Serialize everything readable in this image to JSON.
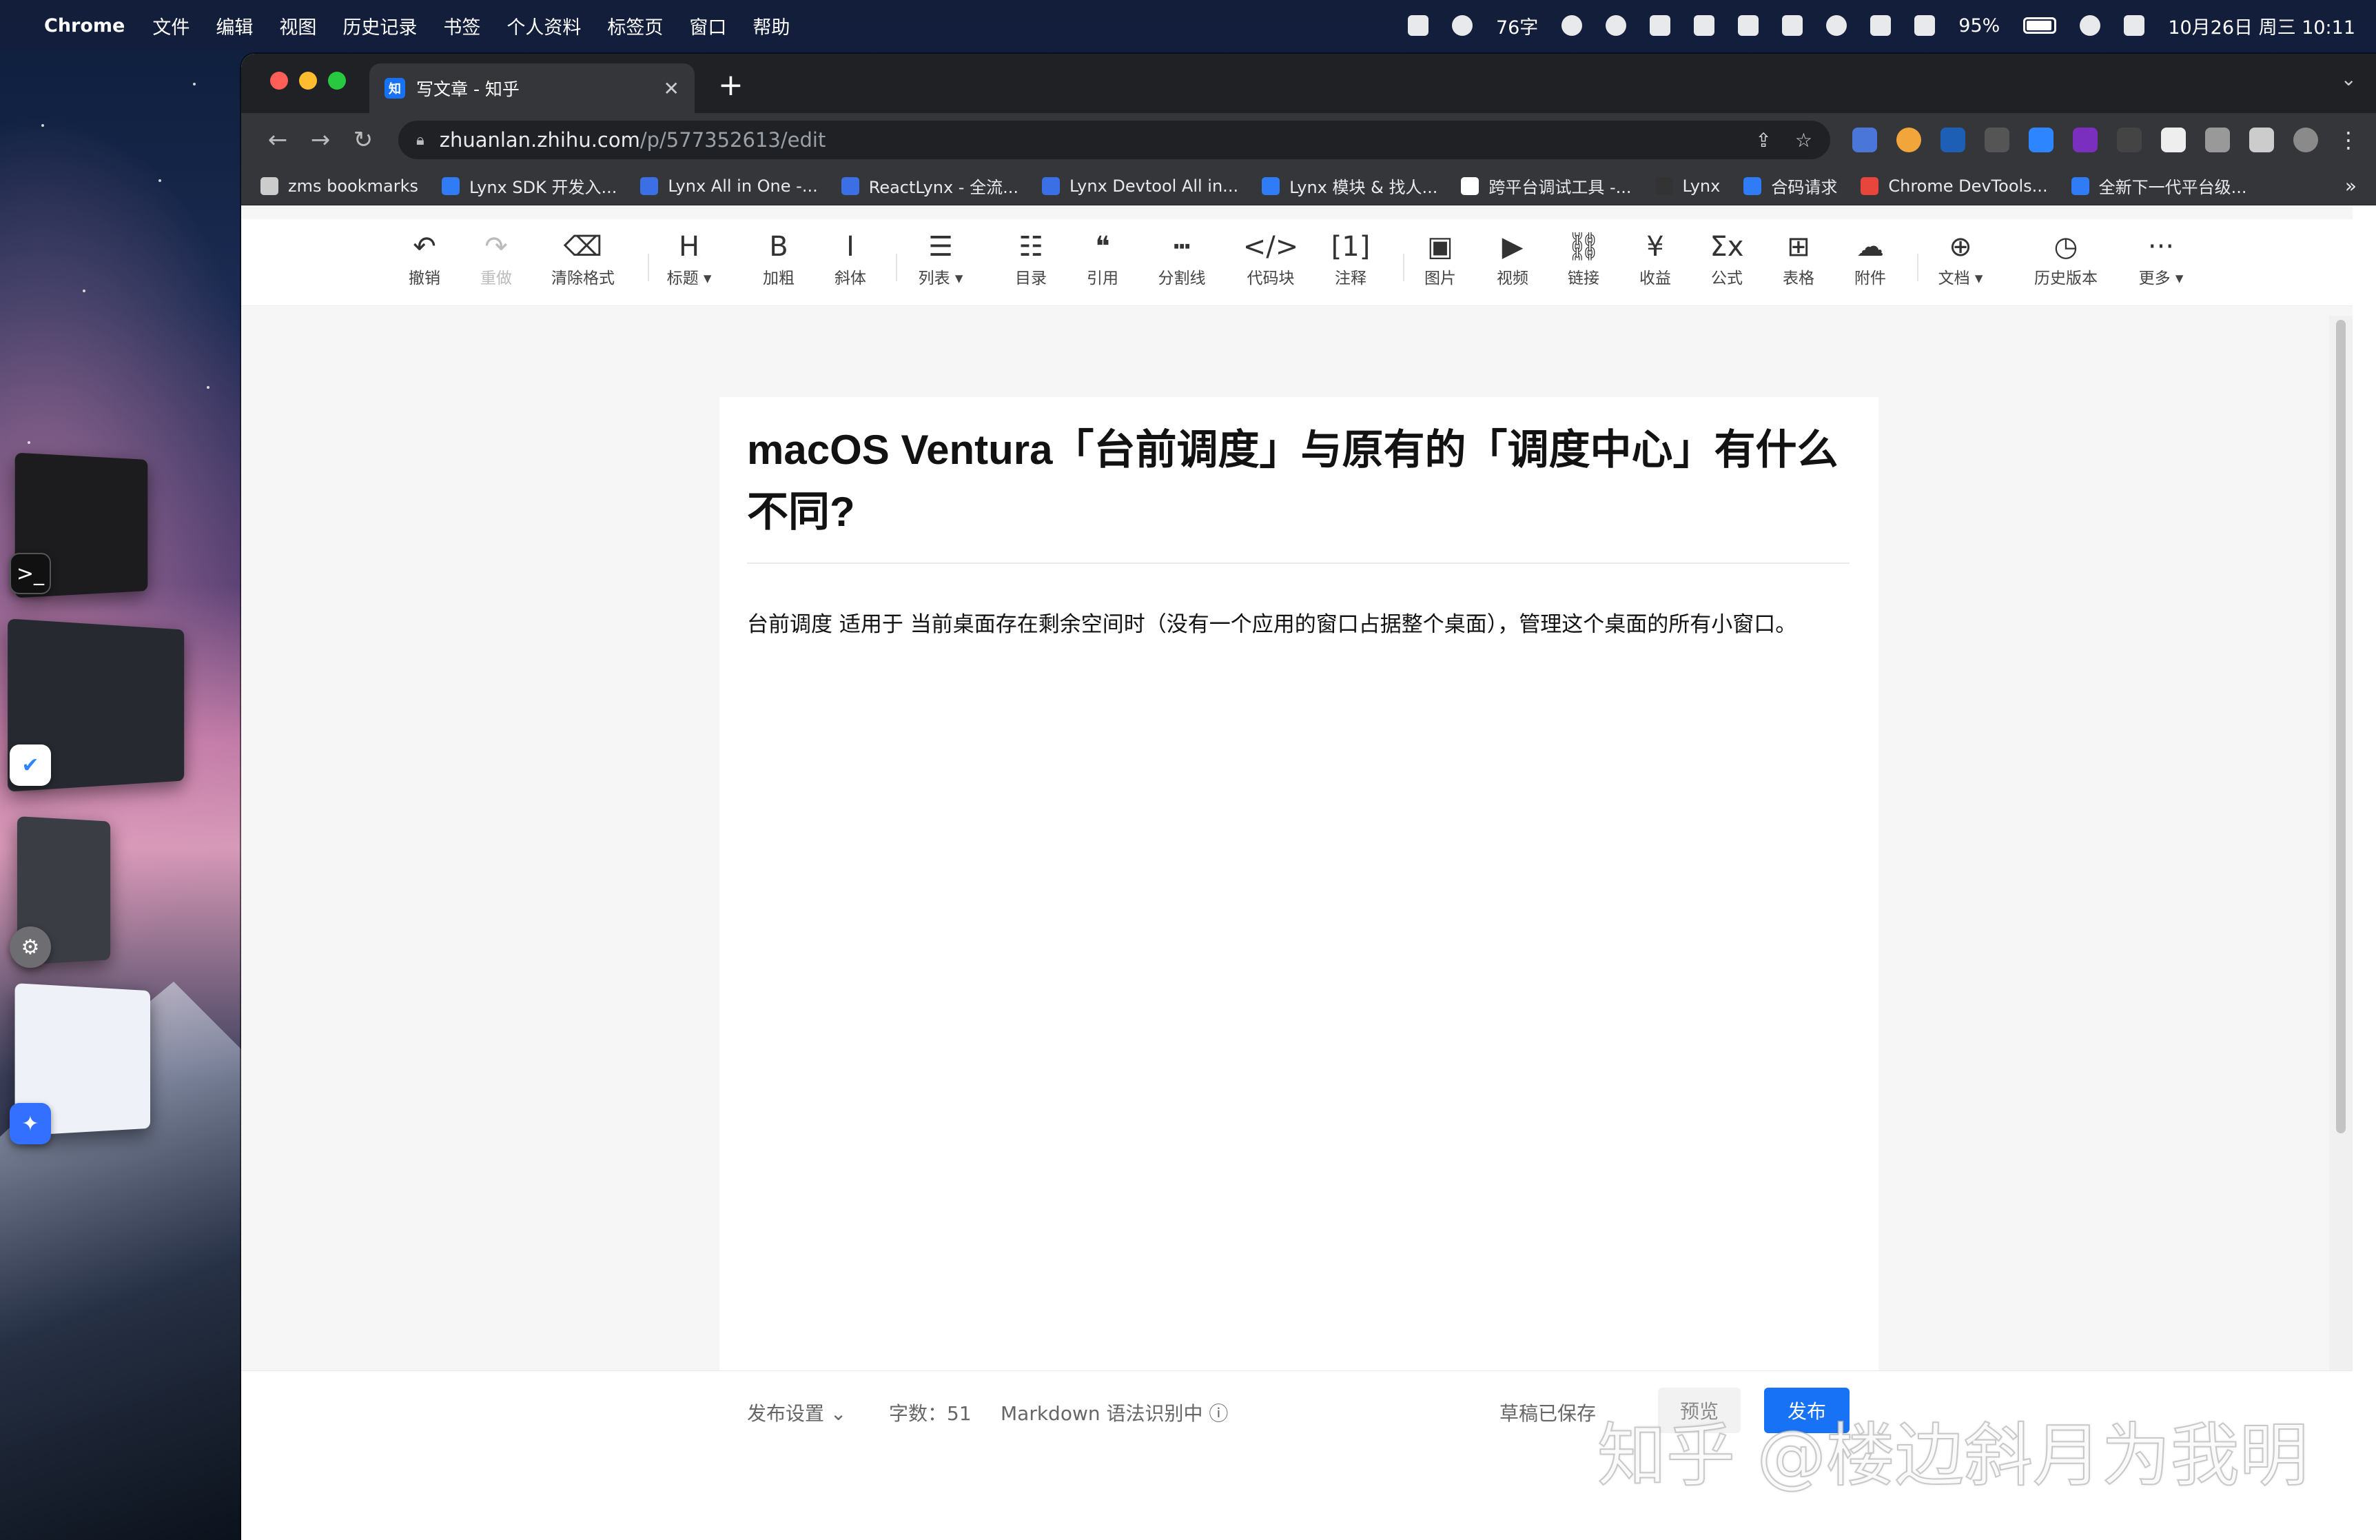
{
  "menubar": {
    "app_name": "Chrome",
    "items": [
      "文件",
      "编辑",
      "视图",
      "历史记录",
      "书签",
      "个人资料",
      "标签页",
      "窗口",
      "帮助"
    ],
    "status": {
      "temperature": "76字",
      "battery": "95%",
      "battery_level": 0.95,
      "datetime": "10月26日 周三 10:11"
    }
  },
  "browser": {
    "tab_title": "写文章 - 知乎",
    "tab_favicon": "知",
    "url_host": "zhuanlan.zhihu.com",
    "url_path": "/p/577352613/edit",
    "bookmarks": [
      {
        "label": "zms bookmarks",
        "icon": "folder-icon",
        "color": "#cccccc"
      },
      {
        "label": "Lynx SDK 开发入...",
        "icon": "lynx-icon",
        "color": "#2f7cf6"
      },
      {
        "label": "Lynx All in One -...",
        "icon": "doc-icon",
        "color": "#3b6fe6"
      },
      {
        "label": "ReactLynx - 全流...",
        "icon": "doc-icon",
        "color": "#3b6fe6"
      },
      {
        "label": "Lynx Devtool All in...",
        "icon": "doc-icon",
        "color": "#3b6fe6"
      },
      {
        "label": "Lynx 模块 & 找人...",
        "icon": "lynx-icon",
        "color": "#2f7cf6"
      },
      {
        "label": "跨平台调试工具 -...",
        "icon": "debug-icon",
        "color": "#ffffff"
      },
      {
        "label": "Lynx",
        "icon": "lynx-bird-icon",
        "color": "#333333"
      },
      {
        "label": "合码请求",
        "icon": "merge-icon",
        "color": "#2f7cf6"
      },
      {
        "label": "Chrome DevTools...",
        "icon": "chrome-icon",
        "color": "#e8453c"
      },
      {
        "label": "全新下一代平台级...",
        "icon": "terminal-icon",
        "color": "#2f7cf6"
      }
    ],
    "bookmarks_more": "»"
  },
  "editor": {
    "toolbar": [
      {
        "label": "撤销",
        "icon": "↶",
        "name": "undo"
      },
      {
        "label": "重做",
        "icon": "↷",
        "name": "redo",
        "disabled": true
      },
      {
        "label": "清除格式",
        "icon": "⌫",
        "name": "clear-format"
      },
      {
        "label": "标题 ▾",
        "icon": "H",
        "name": "heading"
      },
      {
        "label": "加粗",
        "icon": "B",
        "name": "bold"
      },
      {
        "label": "斜体",
        "icon": "I",
        "name": "italic"
      },
      {
        "label": "列表 ▾",
        "icon": "☰",
        "name": "list"
      },
      {
        "label": "目录",
        "icon": "☷",
        "name": "toc"
      },
      {
        "label": "引用",
        "icon": "❝",
        "name": "quote"
      },
      {
        "label": "分割线",
        "icon": "┅",
        "name": "divider"
      },
      {
        "label": "代码块",
        "icon": "</>",
        "name": "code-block"
      },
      {
        "label": "注释",
        "icon": "[1]",
        "name": "footnote"
      },
      {
        "label": "图片",
        "icon": "▣",
        "name": "image"
      },
      {
        "label": "视频",
        "icon": "▶",
        "name": "video"
      },
      {
        "label": "链接",
        "icon": "⛓",
        "name": "link"
      },
      {
        "label": "收益",
        "icon": "¥",
        "name": "income"
      },
      {
        "label": "公式",
        "icon": "Σx",
        "name": "formula"
      },
      {
        "label": "表格",
        "icon": "⊞",
        "name": "table"
      },
      {
        "label": "附件",
        "icon": "☁",
        "name": "attachment"
      },
      {
        "label": "文档 ▾",
        "icon": "⊕",
        "name": "document"
      },
      {
        "label": "历史版本",
        "icon": "◷",
        "name": "history"
      },
      {
        "label": "更多 ▾",
        "icon": "···",
        "name": "more"
      }
    ],
    "title": "macOS Ventura「台前调度」与原有的「调度中心」有什么不同?",
    "body": "台前调度 适用于 当前桌面存在剩余空间时（没有一个应用的窗口占据整个桌面），管理这个桌面的所有小窗口。",
    "footer": {
      "publish_settings": "发布设置  ⌄",
      "word_count": "字数：51",
      "markdown": "Markdown 语法识别中 ⓘ",
      "draft_saved": "草稿已保存",
      "preview": "预览",
      "publish": "发布"
    }
  },
  "watermark": "知乎 @楼边斜月为我明"
}
